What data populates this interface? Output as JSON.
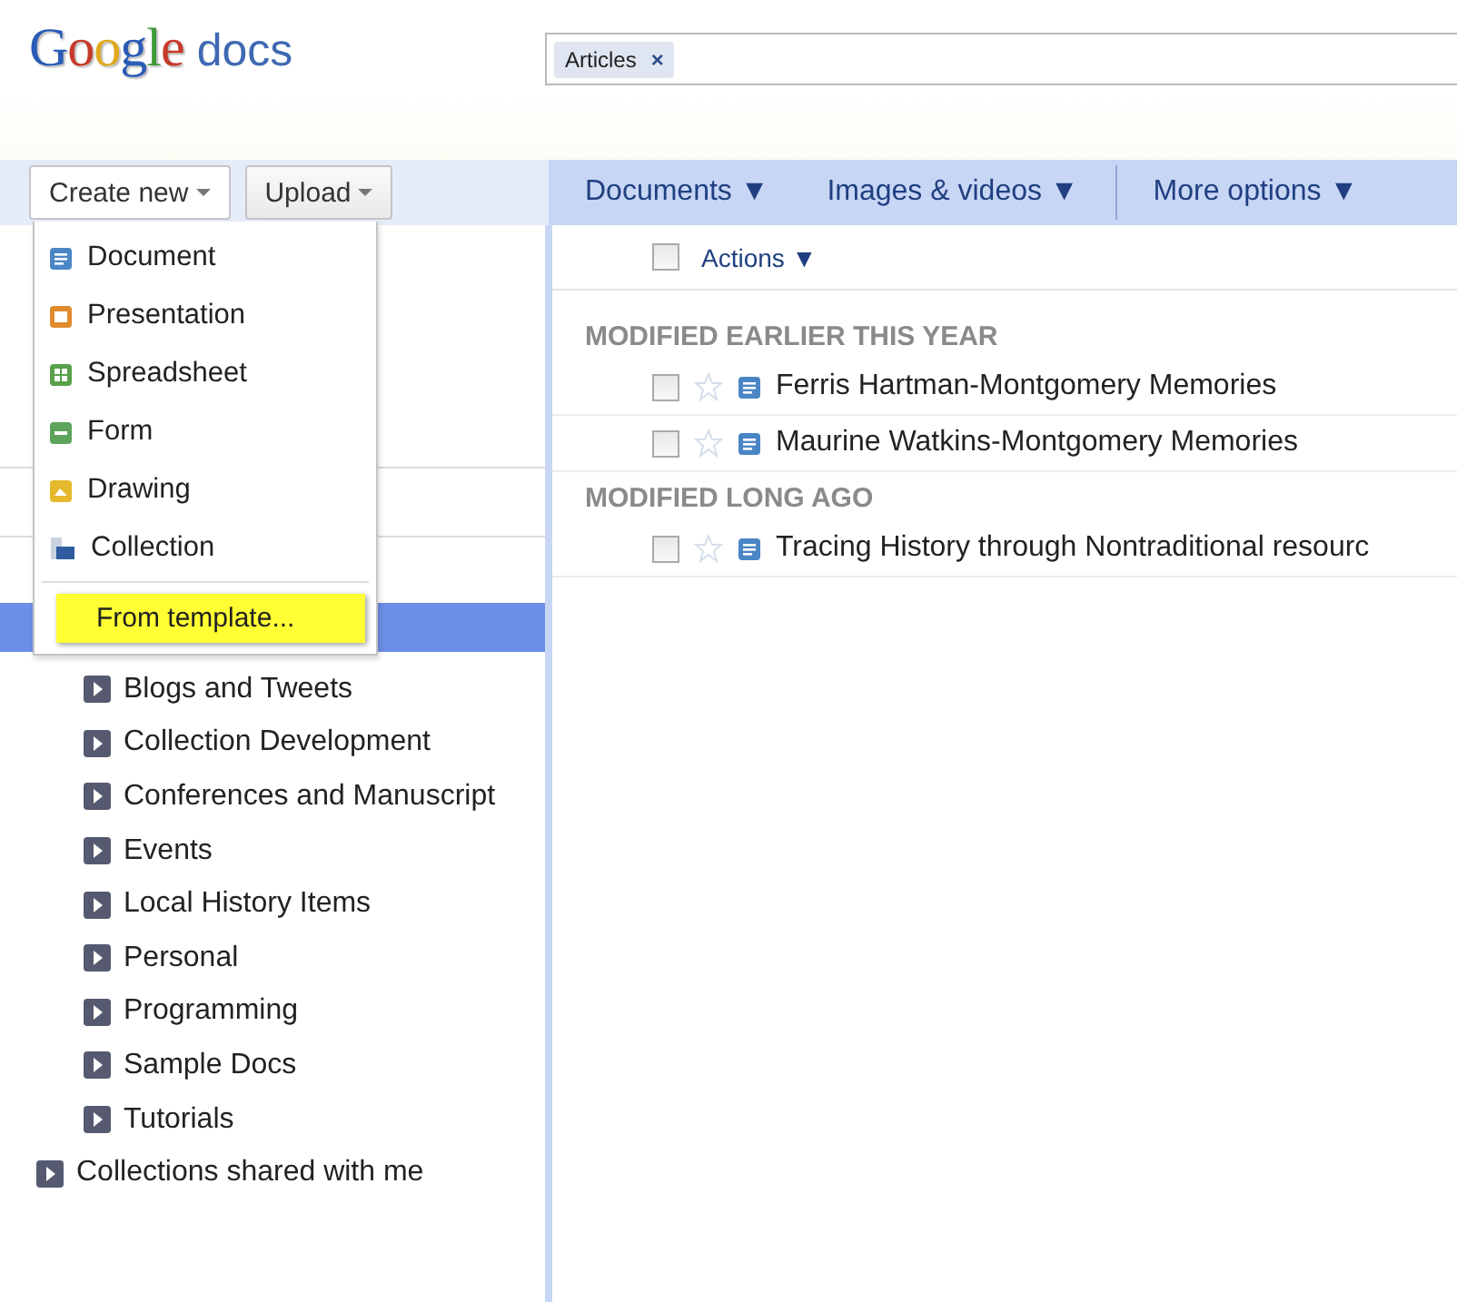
{
  "logo": {
    "brand": "Google",
    "product": "docs"
  },
  "search": {
    "chips": [
      {
        "label": "Articles",
        "remove": "×"
      }
    ]
  },
  "toolbar": {
    "create": {
      "label": "Create new",
      "expanded": true
    },
    "upload": {
      "label": "Upload"
    },
    "filters": [
      {
        "label": "Documents ▼"
      },
      {
        "label": "Images & videos ▼"
      },
      {
        "label": "More options ▼"
      }
    ]
  },
  "create_menu": {
    "items": [
      {
        "label": "Document",
        "kind": "document"
      },
      {
        "label": "Presentation",
        "kind": "presentation"
      },
      {
        "label": "Spreadsheet",
        "kind": "spreadsheet"
      },
      {
        "label": "Form",
        "kind": "form"
      },
      {
        "label": "Drawing",
        "kind": "drawing"
      },
      {
        "label": "Collection",
        "kind": "collection"
      }
    ],
    "template": {
      "label": "From template...",
      "highlighted": true
    }
  },
  "sidebar": {
    "selected_row": {
      "selected": true
    },
    "collections": [
      {
        "label": "Blogs and Tweets",
        "expanded": false
      },
      {
        "label": "Collection Development",
        "expanded": false
      },
      {
        "label": "Conferences and Manuscript",
        "expanded": false
      },
      {
        "label": "Events",
        "expanded": false
      },
      {
        "label": "Local History Items",
        "expanded": false
      },
      {
        "label": "Personal",
        "expanded": false
      },
      {
        "label": "Programming",
        "expanded": false
      },
      {
        "label": "Sample Docs",
        "expanded": false
      },
      {
        "label": "Tutorials",
        "expanded": false
      }
    ],
    "shared": {
      "label": "Collections shared with me",
      "expanded": false
    }
  },
  "list": {
    "actions": {
      "label": "Actions ▼",
      "checked": false
    },
    "groups": [
      {
        "title": "MODIFIED EARLIER THIS YEAR",
        "rows": [
          {
            "title": "Ferris Hartman-Montgomery Memories",
            "checked": false,
            "starred": false
          },
          {
            "title": "Maurine Watkins-Montgomery Memories",
            "checked": false,
            "starred": false
          }
        ]
      },
      {
        "title": "MODIFIED LONG AGO",
        "rows": [
          {
            "title": "Tracing History through Nontraditional resourc",
            "checked": false,
            "starred": false
          }
        ]
      }
    ]
  }
}
